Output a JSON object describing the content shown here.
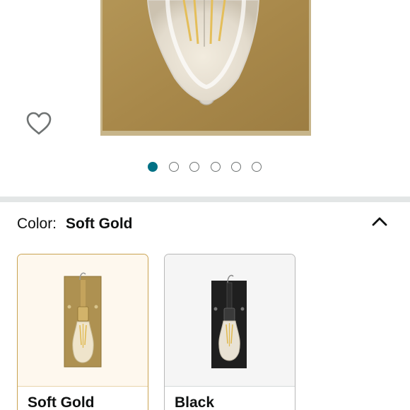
{
  "colors": {
    "accent": "#007185",
    "selected_border": "#c9a250",
    "soft_gold": "#ae9151",
    "black": "#1f1f1f"
  },
  "gallery": {
    "image_count": 6,
    "active_index": 0
  },
  "icons": {
    "wishlist": "heart-outline-icon",
    "collapse": "chevron-up-icon"
  },
  "color_selector": {
    "label": "Color:",
    "selected": "Soft Gold",
    "options": [
      {
        "name": "Soft Gold",
        "selected": true
      },
      {
        "name": "Black",
        "selected": false
      }
    ]
  }
}
